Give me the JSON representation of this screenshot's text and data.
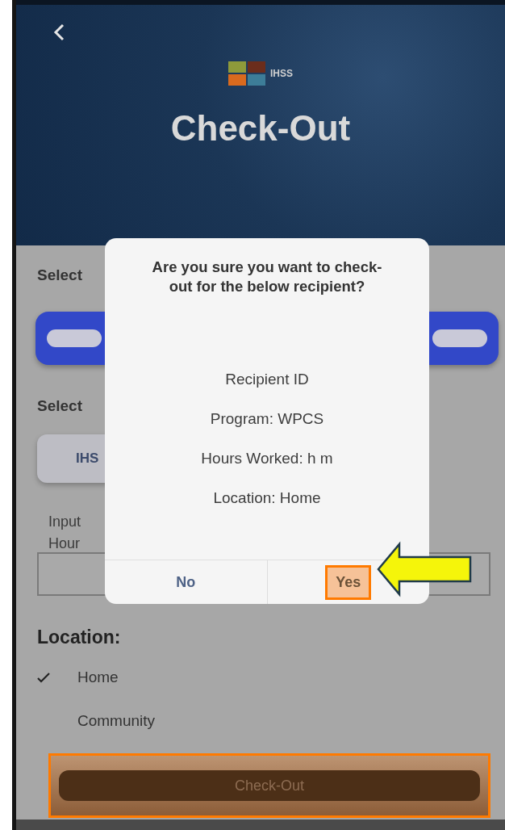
{
  "header": {
    "logo_text": "IHSS",
    "title": "Check-Out"
  },
  "form": {
    "select_label_1": "Select",
    "select_label_2": "Select",
    "program_chip": "IHS",
    "input_label": "Input",
    "hours_label": "Hour",
    "location_title": "Location:",
    "locations": [
      {
        "label": "Home",
        "selected": true
      },
      {
        "label": "Community",
        "selected": false
      }
    ]
  },
  "dialog": {
    "message": "Are you sure you want to check-out for the below recipient?",
    "details": [
      "Recipient ID",
      "Program: WPCS",
      "Hours Worked: h m",
      "Location: Home"
    ],
    "buttons": [
      {
        "label": "No",
        "highlighted": false
      },
      {
        "label": "Yes",
        "highlighted": true
      }
    ]
  },
  "footer": {
    "button": "Check-Out",
    "highlighted": true
  }
}
